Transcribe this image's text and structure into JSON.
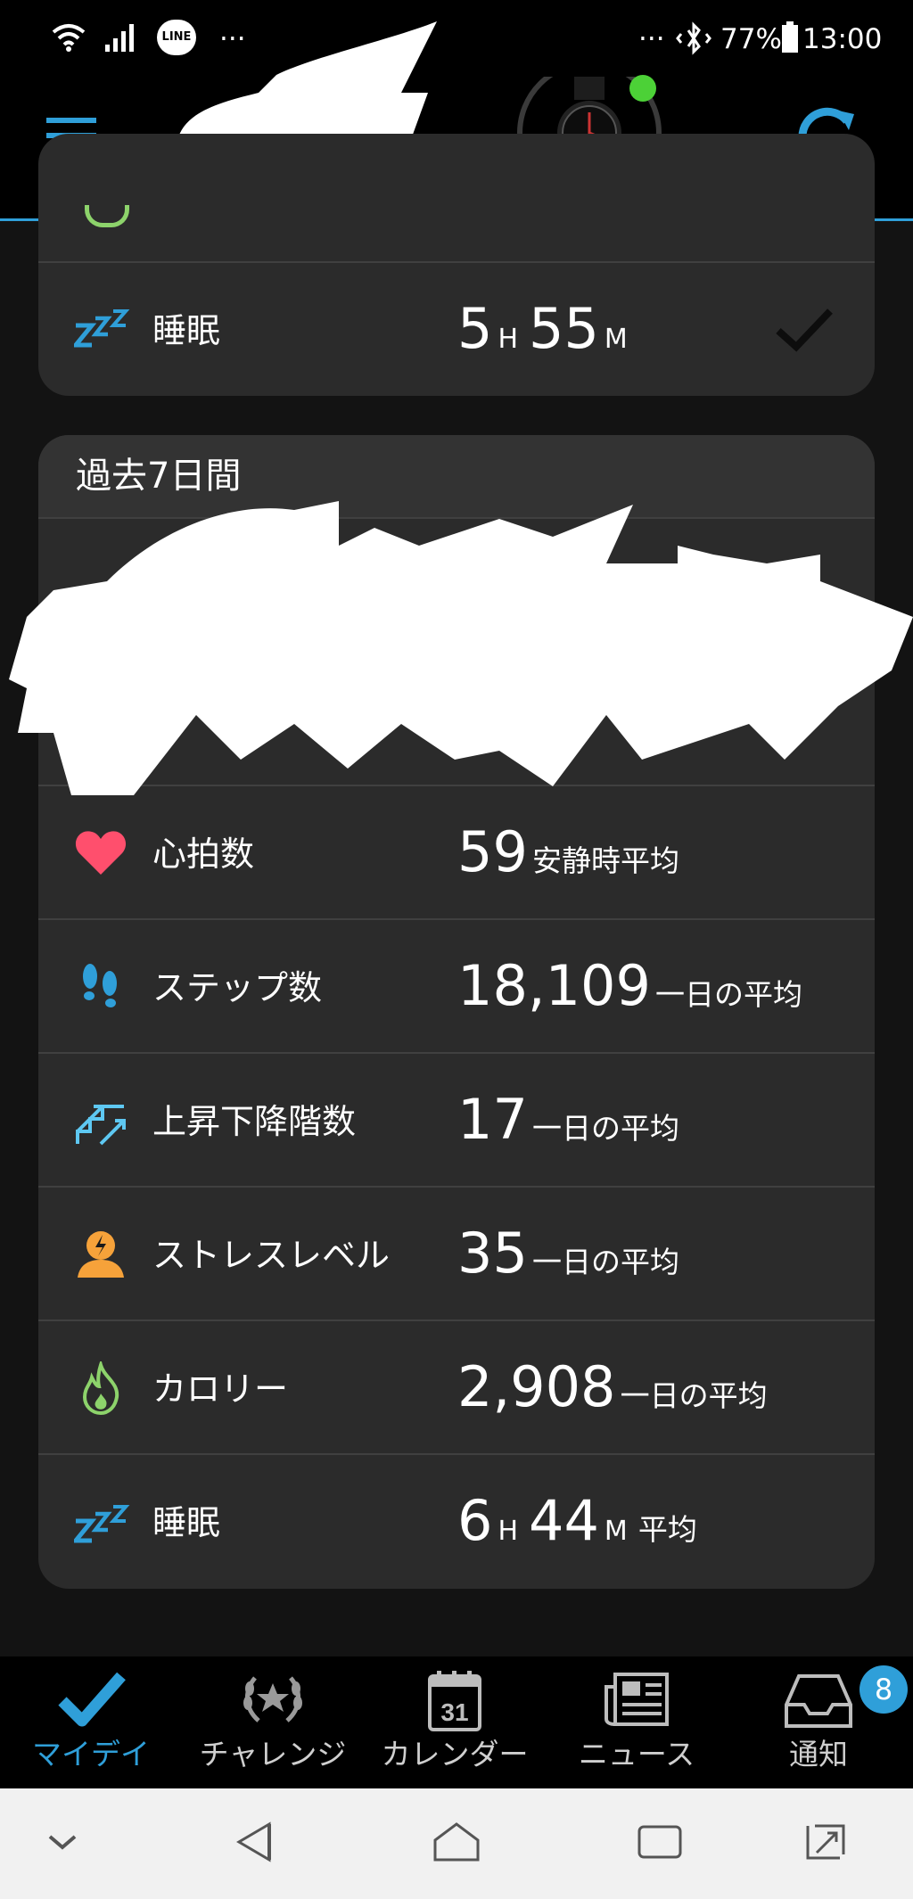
{
  "status_bar": {
    "icons_left": [
      "wifi-icon",
      "signal-icon",
      "line-app-icon"
    ],
    "line_label": "LINE",
    "dots": "···",
    "dots_right": "···",
    "battery": "77%",
    "time": "13:00"
  },
  "header": {
    "menu_icon": "hamburger-menu-icon",
    "device_icon": "watch-icon",
    "device_connected_color": "#4cd137",
    "sync_icon": "sync-icon",
    "accent_color": "#2f9fd9"
  },
  "today_card": {
    "rows": [
      {
        "icon": "sleep-icon",
        "label": "睡眠",
        "hours": "5",
        "h_unit": "H",
        "minutes": "55",
        "m_unit": "M",
        "check_icon": "check-icon"
      }
    ]
  },
  "past7": {
    "title": "過去7日間",
    "rows": [
      {
        "key": "heart-rate",
        "icon": "heart-icon",
        "label": "心拍数",
        "value": "59",
        "sub": "安静時平均"
      },
      {
        "key": "steps",
        "icon": "steps-icon",
        "label": "ステップ数",
        "value": "18,109",
        "sub": "一日の平均"
      },
      {
        "key": "floors",
        "icon": "stairs-icon",
        "label": "上昇下降階数",
        "value": "17",
        "sub": "一日の平均"
      },
      {
        "key": "stress",
        "icon": "stress-icon",
        "label": "ストレスレベル",
        "value": "35",
        "sub": "一日の平均"
      },
      {
        "key": "calories",
        "icon": "flame-icon",
        "label": "カロリー",
        "value": "2,908",
        "sub": "一日の平均"
      }
    ],
    "sleep": {
      "icon": "sleep-icon",
      "label": "睡眠",
      "hours": "6",
      "h_unit": "H",
      "minutes": "44",
      "m_unit": "M",
      "sub": "平均"
    }
  },
  "bottom_nav": {
    "active_color": "#2f9fd9",
    "items": [
      {
        "label": "マイデイ",
        "icon": "checkmark-icon"
      },
      {
        "label": "チャレンジ",
        "icon": "laurel-trophy-icon"
      },
      {
        "label": "カレンダー",
        "icon": "calendar-icon",
        "day": "31"
      },
      {
        "label": "ニュース",
        "icon": "newspaper-icon"
      },
      {
        "label": "通知",
        "icon": "inbox-icon",
        "badge": "8"
      }
    ]
  },
  "system_nav": [
    "chevron-down-icon",
    "back-icon",
    "home-icon",
    "recents-icon",
    "rotate-icon"
  ]
}
